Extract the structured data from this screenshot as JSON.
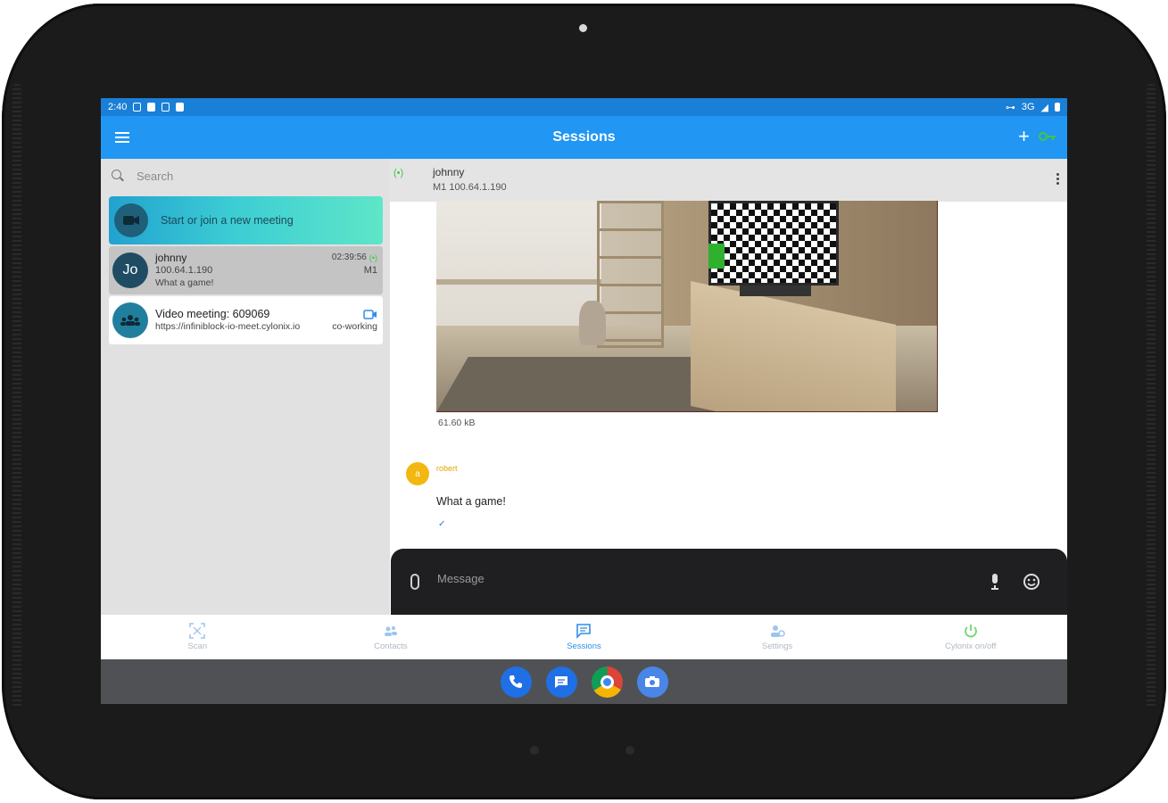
{
  "statusbar": {
    "time": "2:40",
    "network": "3G"
  },
  "appbar": {
    "title": "Sessions"
  },
  "search": {
    "placeholder": "Search"
  },
  "meeting_card": {
    "label": "Start or join a new meeting"
  },
  "chats": [
    {
      "avatar": "Jo",
      "name": "johnny",
      "time": "02:39:56",
      "address": "100.64.1.190",
      "tag": "M1",
      "last": "What a game!"
    },
    {
      "title": "Video meeting: 609069",
      "url": "https://infiniblock-io-meet.cylonix.io",
      "room": "co-working"
    }
  ],
  "chat": {
    "name": "johnny",
    "sub": "M1 100.64.1.190",
    "file_size": "61.60 kB",
    "sender_avatar": "a",
    "sender": "robert",
    "message": "What a game!",
    "check": "✓"
  },
  "composer": {
    "placeholder": "Message"
  },
  "nav": [
    {
      "label": "Scan",
      "icon": "scan-icon"
    },
    {
      "label": "Contacts",
      "icon": "contacts-icon"
    },
    {
      "label": "Sessions",
      "icon": "sessions-icon"
    },
    {
      "label": "Settings",
      "icon": "settings-icon"
    },
    {
      "label": "Cylonix on/off",
      "icon": "power-icon"
    }
  ],
  "dock": [
    "phone-icon",
    "messages-icon",
    "chrome-icon",
    "camera-icon"
  ],
  "colors": {
    "primary": "#2196f3",
    "statusbar": "#1a7fd6",
    "active_nav": "#2f8ee8",
    "composer": "#1f1f22",
    "avatar_sender": "#f2b711"
  }
}
